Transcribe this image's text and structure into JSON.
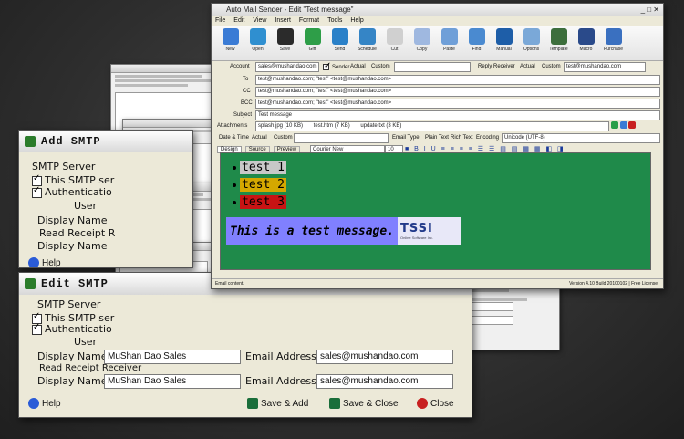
{
  "add_smtp": {
    "title": "Add SMTP",
    "smtp_server_label": "SMTP Server",
    "this_smtp_label": "This SMTP ser",
    "auth_label": "Authenticatio",
    "user_label": "User",
    "display_name_label": "Display Name",
    "read_receipt_label": "Read Receipt R",
    "display_name2_label": "Display Name",
    "help_label": "Help"
  },
  "edit_smtp": {
    "title": "Edit SMTP",
    "smtp_server_label": "SMTP Server",
    "this_smtp_label": "This SMTP ser",
    "auth_label": "Authenticatio",
    "user_label": "User",
    "display_name_label": "Display Name",
    "display_name_value": "MuShan Dao Sales",
    "email_label": "Email Address",
    "email_value": "sales@mushandao.com",
    "read_receipt_label": "Read Receipt Receiver",
    "rr_display_name_label": "Display Name",
    "rr_display_name_value": "MuShan Dao Sales",
    "rr_email_label": "Email Address",
    "rr_email_value": "sales@mushandao.com",
    "help_label": "Help",
    "save_add_label": "Save & Add",
    "save_close_label": "Save & Close",
    "close_label": "Close"
  },
  "main": {
    "title": "Auto Mail Sender - Edit \"Test message\"",
    "menu": [
      "File",
      "Edit",
      "View",
      "Insert",
      "Format",
      "Tools",
      "Help"
    ],
    "toolbar": [
      "New",
      "Open",
      "Save",
      "Gift",
      "Send",
      "Schedule",
      "Cut",
      "Copy",
      "Paste",
      "Find",
      "Manual",
      "Options",
      "Template",
      "Macro",
      "Purchase"
    ],
    "account_label": "Account",
    "account_value": "sales@mushandao.com",
    "sender_label": "Sender",
    "actual_label": "Actual",
    "custom_label": "Custom",
    "reply_label": "Reply Receiver",
    "reply_value": "test@mushandao.com",
    "to_label": "To",
    "to_value": "test@mushandao.com; \"test\" <test@mushandao.com>",
    "cc_label": "CC",
    "cc_value": "test@mushandao.com; \"test\" <test@mushandao.com>",
    "bcc_label": "BCC",
    "bcc_value": "test@mushandao.com; \"test\" <test@mushandao.com>",
    "subject_label": "Subject",
    "subject_value": "Test message",
    "attachments_label": "Attachments",
    "attachments": [
      "splash.jpg (10 KB)",
      "test.htm (7 KB)",
      "update.txt (3 KB)"
    ],
    "date_label": "Date & Time",
    "email_type_label": "Email Type",
    "plain_text_label": "Plain Text",
    "rich_text_label": "Rich Text",
    "encoding_label": "Encoding",
    "encoding_value": "Unicode (UTF-8)",
    "tabs": [
      "Design",
      "Source",
      "Preview"
    ],
    "font_value": "Courier New",
    "size_value": "10",
    "body_lines": [
      "test 1",
      "test 2",
      "test 3"
    ],
    "body_colors": [
      "#c8c8c8",
      "#d4a800",
      "#c81414"
    ],
    "message": "This is a test message.",
    "logo_text": "TSSI",
    "logo_sub": "Online Software Inc.",
    "status_left": "Email content.",
    "status_right": "Version 4.10 Build 20100102 | Free License"
  }
}
